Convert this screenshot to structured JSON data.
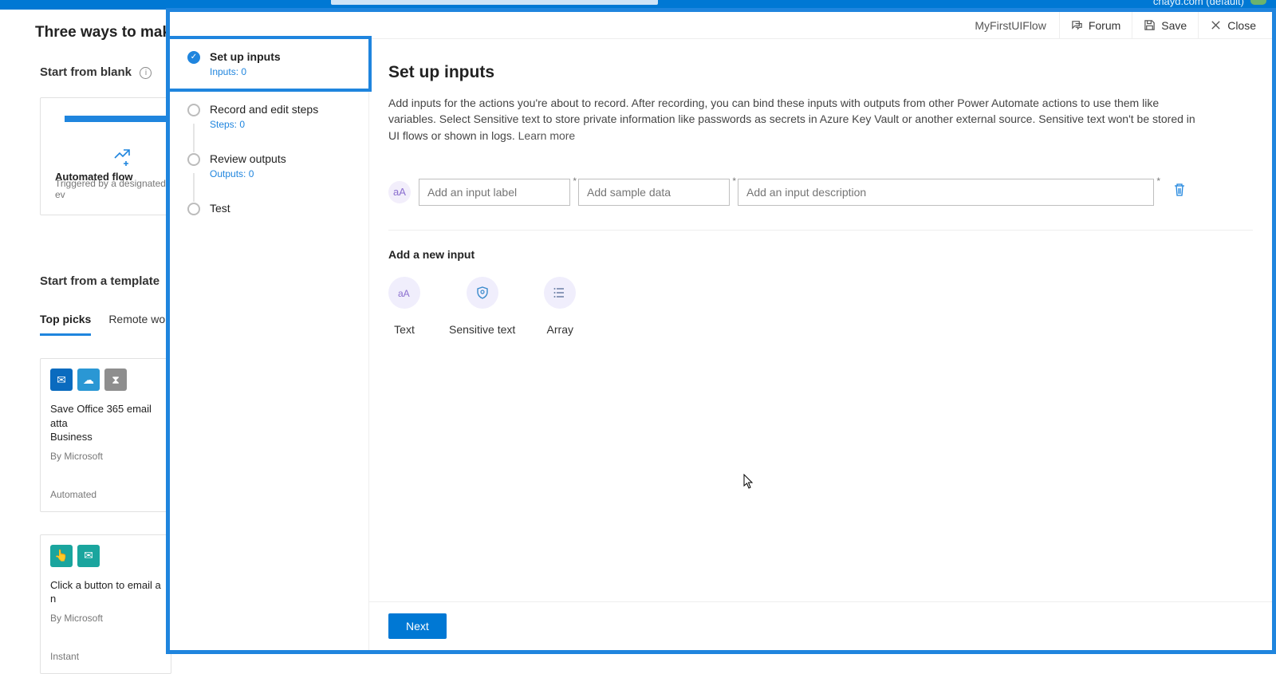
{
  "topbar": {
    "account_text": "cnayd.com (default)"
  },
  "background": {
    "page_heading": "Three ways to make a",
    "blank_section_title": "Start from blank",
    "blank_card": {
      "title": "Automated flow",
      "subtitle": "Triggered by a designated ev"
    },
    "template_section_title": "Start from a template",
    "tabs": [
      "Top picks",
      "Remote work"
    ],
    "active_tab": 0,
    "template_cards": [
      {
        "title_line1": "Save Office 365 email atta",
        "title_line2": "Business",
        "by": "By Microsoft",
        "kind": "Automated",
        "icons": [
          {
            "bg": "#0a6bbf",
            "glyph": "✉"
          },
          {
            "bg": "#2a97d4",
            "glyph": "☁"
          },
          {
            "bg": "#8e8e8e",
            "glyph": "⧗"
          }
        ]
      },
      {
        "title_line1": "Click a button to email a n",
        "title_line2": "",
        "by": "By Microsoft",
        "kind": "Instant",
        "icons": [
          {
            "bg": "#1aa59e",
            "glyph": "👆"
          },
          {
            "bg": "#1aa59e",
            "glyph": "✉"
          }
        ]
      }
    ]
  },
  "modal": {
    "flow_name": "MyFirstUIFlow",
    "forum_label": "Forum",
    "save_label": "Save",
    "close_label": "Close",
    "steps": [
      {
        "title": "Set up inputs",
        "meta_label": "Inputs:",
        "meta_value": "0",
        "selected": true
      },
      {
        "title": "Record and edit steps",
        "meta_label": "Steps:",
        "meta_value": "0",
        "selected": false
      },
      {
        "title": "Review outputs",
        "meta_label": "Outputs:",
        "meta_value": "0",
        "selected": false
      },
      {
        "title": "Test",
        "meta_label": "",
        "meta_value": "",
        "selected": false
      }
    ],
    "heading": "Set up inputs",
    "help_text": "Add inputs for the actions you're about to record. After recording, you can bind these inputs with outputs from other Power Automate actions to use them like variables. Select Sensitive text to store private information like passwords as secrets in Azure Key Vault or another external source. Sensitive text won't be stored in UI flows or shown in logs. ",
    "learn_more": "Learn more",
    "input_row": {
      "type_glyph": "aA",
      "label_ph": "Add an input label",
      "sample_ph": "Add sample data",
      "desc_ph": "Add an input description"
    },
    "add_new_heading": "Add a new input",
    "add_options": [
      {
        "label": "Text",
        "icon": "text"
      },
      {
        "label": "Sensitive text",
        "icon": "shield"
      },
      {
        "label": "Array",
        "icon": "list"
      }
    ],
    "next_label": "Next"
  }
}
